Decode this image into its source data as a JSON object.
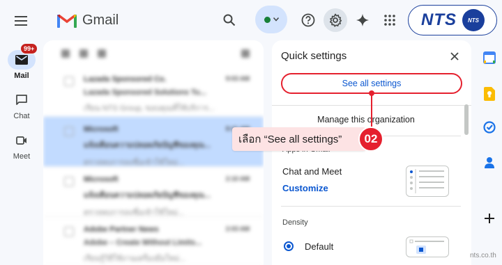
{
  "app": {
    "name": "Gmail"
  },
  "nav": {
    "items": [
      {
        "label": "Mail",
        "badge": "99+"
      },
      {
        "label": "Chat"
      },
      {
        "label": "Meet"
      }
    ]
  },
  "inbox": {
    "rows": [
      {
        "l1": "Lazada Sponsored Co.",
        "l2": "Lazada Sponsored Solutions Tu...",
        "l3": "เรียน NTS Group, ขอบคุณที่ใช้บริการ...",
        "time": "9:03 AM"
      },
      {
        "l1": "Microsoft",
        "l2": "แจ้งเตือนความปลอดภัยบัญชีของคุณ...",
        "l3": "ตรวจพบการลงชื่อเข้าใช้ใหม่...",
        "time": "8:41 AM"
      },
      {
        "l1": "Microsoft",
        "l2": "แจ้งเตือนความปลอดภัยบัญชีของคุณ...",
        "l3": "ตรวจพบการลงชื่อเข้าใช้ใหม่...",
        "time": "2:10 AM"
      },
      {
        "l1": "Adobe Partner News",
        "l2": "Adobe – Create Without Limits...",
        "l3": "เรียนรู้วิธีใช้งานเครื่องมือใหม่...",
        "time": "2:03 AM"
      }
    ]
  },
  "quick_settings": {
    "title": "Quick settings",
    "see_all_label": "See all settings",
    "manage_label": "Manage this organization",
    "apps_header": "Apps in Gmail",
    "chat_meet_label": "Chat and Meet",
    "customize_label": "Customize",
    "density_header": "Density",
    "density_selected": "Default"
  },
  "callout": {
    "text": "เลือก “See all settings”",
    "step": "02",
    "color": "#e5202e"
  },
  "brand": {
    "logo_text": "NTS",
    "badge_text": "NTS",
    "watermark": "nts.co.th"
  },
  "colors": {
    "accent": "#0b57d0",
    "highlight": "#e5202e",
    "nts_blue": "#1a3f9c"
  }
}
